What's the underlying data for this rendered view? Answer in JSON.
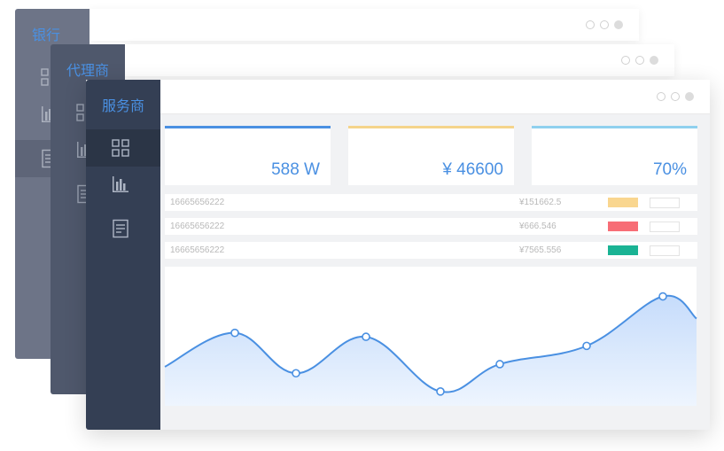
{
  "windows": {
    "bank": {
      "title": "银行"
    },
    "agent": {
      "title": "代理商"
    },
    "provider": {
      "title": "服务商"
    }
  },
  "nav_icons": [
    "dashboard-icon",
    "bar-chart-icon",
    "document-icon"
  ],
  "stats": [
    {
      "value": "588 W",
      "accent": "#4a90e2"
    },
    {
      "value": "¥ 46600",
      "accent": "#f5d48a"
    },
    {
      "value": "70%",
      "accent": "#8fd0ee"
    }
  ],
  "rows": [
    {
      "phone": "16665656222",
      "amount": "¥151662.5",
      "tag_color": "#f9d68f"
    },
    {
      "phone": "16665656222",
      "amount": "¥666.546",
      "tag_color": "#f76d76"
    },
    {
      "phone": "16665656222",
      "amount": "¥7565.556",
      "tag_color": "#1ab394"
    }
  ],
  "chart_data": {
    "type": "area",
    "points": [
      {
        "x": 1,
        "y": 56
      },
      {
        "x": 2,
        "y": 25
      },
      {
        "x": 3,
        "y": 53
      },
      {
        "x": 4,
        "y": 11
      },
      {
        "x": 5,
        "y": 32
      },
      {
        "x": 6,
        "y": 46
      },
      {
        "x": 7,
        "y": 84
      }
    ],
    "grid": false,
    "colors": {
      "line": "#4a90e2",
      "fill_top": "#c6dcfb",
      "fill_bottom": "#eef5fe"
    }
  }
}
